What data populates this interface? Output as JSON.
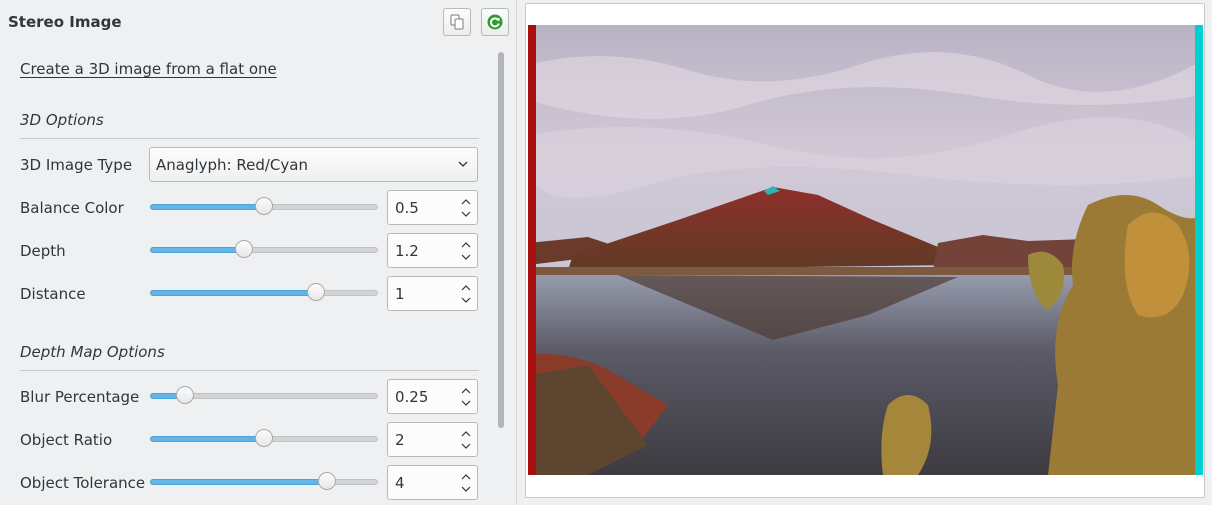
{
  "panel": {
    "title": "Stereo Image",
    "link_text": "Create a 3D image from a flat one",
    "header_buttons": [
      {
        "icon": "copy-icon"
      },
      {
        "icon": "refresh-icon",
        "color": "#2e9c2e"
      }
    ]
  },
  "options_3d": {
    "section_title": "3D Options",
    "image_type": {
      "label": "3D Image Type",
      "value": "Anaglyph: Red/Cyan"
    },
    "balance_color": {
      "label": "Balance Color",
      "value": "0.5",
      "level": 0.5
    },
    "depth": {
      "label": "Depth",
      "value": "1.2",
      "level": 0.41
    },
    "distance": {
      "label": "Distance",
      "value": "1",
      "level": 0.73
    }
  },
  "depth_map_options": {
    "section_title": "Depth Map Options",
    "blur_percentage": {
      "label": "Blur Percentage",
      "value": "0.25",
      "level": 0.15
    },
    "object_ratio": {
      "label": "Object Ratio",
      "value": "2",
      "level": 0.5
    },
    "object_tolerance": {
      "label": "Object Tolerance",
      "value": "4",
      "level": 0.78
    }
  },
  "colors": {
    "accent": "#64b4e6",
    "anaglyph_red": "#a80f0f",
    "anaglyph_cyan": "#00d0d0"
  }
}
